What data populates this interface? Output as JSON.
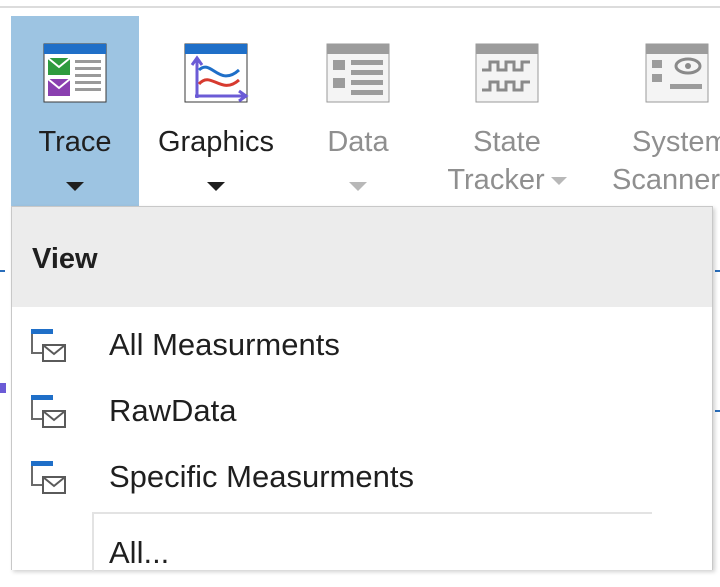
{
  "ribbon": {
    "buttons": [
      {
        "label": "Trace",
        "icon": "trace-icon",
        "state": "active"
      },
      {
        "label": "Graphics",
        "icon": "graphics-icon",
        "state": "enabled"
      },
      {
        "label": "Data",
        "icon": "data-icon",
        "state": "disabled"
      },
      {
        "label_line1": "State",
        "label_line2": "Tracker",
        "icon": "state-tracker-icon",
        "state": "disabled"
      },
      {
        "label_line1": "System",
        "label_line2": "Scanner",
        "icon": "system-scanner-icon",
        "state": "disabled"
      }
    ]
  },
  "menu": {
    "header": "View",
    "items": [
      {
        "label": "All Measurments",
        "icon": "trace-window-icon"
      },
      {
        "label": "RawData",
        "icon": "trace-window-icon"
      },
      {
        "label": "Specific Measurments",
        "icon": "trace-window-icon"
      },
      {
        "label": "All..."
      }
    ]
  },
  "colors": {
    "active_button_bg": "#9dc4e2",
    "icon_blue": "#1f6fc8",
    "icon_green": "#2e9b3e",
    "icon_purple": "#8a3fb0",
    "menu_header_bg": "#ececec",
    "disabled_text": "#8f8f8f"
  }
}
